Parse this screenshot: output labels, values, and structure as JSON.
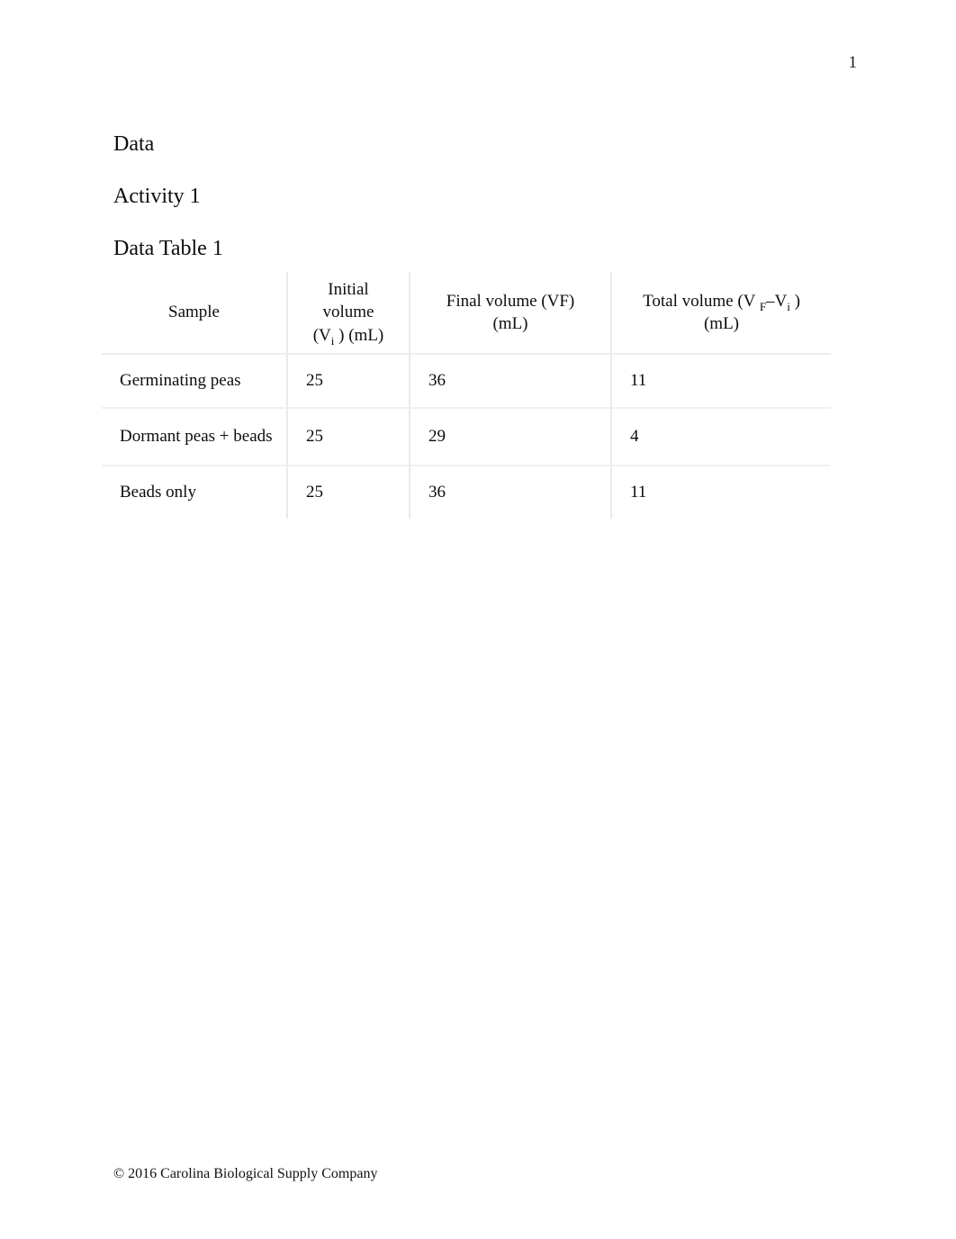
{
  "page": {
    "number": "1"
  },
  "headings": {
    "data": "Data",
    "activity": "Activity 1",
    "table_title": "Data Table 1"
  },
  "table": {
    "headers": {
      "sample": "Sample",
      "initial_line1": "Initial",
      "initial_line2": "volume",
      "initial_line3_pre": "(V",
      "initial_line3_sub": "i",
      "initial_line3_post": " ) (mL)",
      "final_line1": "Final volume (VF)",
      "final_line2": "(mL)",
      "total_line1_pre": "Total volume (V ",
      "total_line1_sub1": "F",
      "total_line1_mid": "–V",
      "total_line1_sub2": "i",
      "total_line1_post": " )",
      "total_line2": "(mL)"
    },
    "rows": [
      {
        "sample": "Germinating peas",
        "initial_volume": "25",
        "final_volume": "36",
        "total_volume": "11"
      },
      {
        "sample": "Dormant peas + beads",
        "initial_volume": "25",
        "final_volume": "29",
        "total_volume": "4"
      },
      {
        "sample": "Beads only",
        "initial_volume": "25",
        "final_volume": "36",
        "total_volume": "11"
      }
    ]
  },
  "footer": {
    "copyright": "© 2016 Carolina Biological Supply Company"
  },
  "colors": {
    "value_blue": "#3d6fa8",
    "text_black": "#0d0d0d",
    "cell_border": "#eaeaea"
  }
}
